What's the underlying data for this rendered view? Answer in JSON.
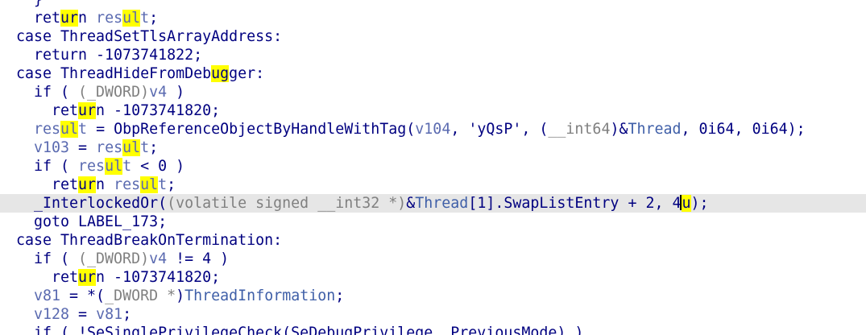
{
  "theme": {
    "background": "#ffffff",
    "current_line": "#e6e6e6",
    "highlight": "#ffff00",
    "colors": {
      "kw": "#000080",
      "var": "#5a6ab0",
      "gvar": "#3f5fa8",
      "cmt": "#808080",
      "str": "#008000",
      "num": "#000080",
      "plain": "#000080"
    }
  },
  "editor": {
    "current_line_index": 11,
    "lines": [
      {
        "indent": 2,
        "tokens": [
          [
            "kw",
            "}"
          ]
        ]
      },
      {
        "indent": 2,
        "tokens": [
          [
            "kw",
            "ret"
          ],
          [
            "kw",
            "ur",
            "hl"
          ],
          [
            "kw",
            "n "
          ],
          [
            "var",
            "res"
          ],
          [
            "var",
            "ul",
            "hl"
          ],
          [
            "var",
            "t"
          ],
          [
            "kw",
            ";"
          ]
        ]
      },
      {
        "indent": 1,
        "tokens": [
          [
            "kw",
            "case ThreadSetTlsArrayAddress:"
          ]
        ]
      },
      {
        "indent": 2,
        "tokens": [
          [
            "kw",
            "return -1073741822;"
          ]
        ]
      },
      {
        "indent": 1,
        "tokens": [
          [
            "kw",
            "case ThreadHideFromDeb"
          ],
          [
            "kw",
            "ug",
            "hl"
          ],
          [
            "kw",
            "ger:"
          ]
        ]
      },
      {
        "indent": 2,
        "tokens": [
          [
            "kw",
            "if ( "
          ],
          [
            "cmt",
            "(_DWORD)"
          ],
          [
            "var",
            "v4"
          ],
          [
            "kw",
            " )"
          ]
        ]
      },
      {
        "indent": 3,
        "tokens": [
          [
            "kw",
            "ret"
          ],
          [
            "kw",
            "ur",
            "hl"
          ],
          [
            "kw",
            "n -1073741820;"
          ]
        ]
      },
      {
        "indent": 2,
        "tokens": [
          [
            "var",
            "res"
          ],
          [
            "var",
            "ul",
            "hl"
          ],
          [
            "var",
            "t"
          ],
          [
            "kw",
            " = ObpReferenceObjectByHandleWithTag("
          ],
          [
            "var",
            "v104"
          ],
          [
            "kw",
            ", 'yQsP', ("
          ],
          [
            "cmt",
            "__int64"
          ],
          [
            "kw",
            ")&"
          ],
          [
            "gvar",
            "Thread"
          ],
          [
            "kw",
            ", 0i64, 0i64);"
          ]
        ]
      },
      {
        "indent": 2,
        "tokens": [
          [
            "var",
            "v103"
          ],
          [
            "kw",
            " = "
          ],
          [
            "var",
            "res"
          ],
          [
            "var",
            "ul",
            "hl"
          ],
          [
            "var",
            "t"
          ],
          [
            "kw",
            ";"
          ]
        ]
      },
      {
        "indent": 2,
        "tokens": [
          [
            "kw",
            "if ( "
          ],
          [
            "var",
            "res"
          ],
          [
            "var",
            "ul",
            "hl"
          ],
          [
            "var",
            "t"
          ],
          [
            "kw",
            " < 0 )"
          ]
        ]
      },
      {
        "indent": 3,
        "tokens": [
          [
            "kw",
            "ret"
          ],
          [
            "kw",
            "ur",
            "hl"
          ],
          [
            "kw",
            "n "
          ],
          [
            "var",
            "res"
          ],
          [
            "var",
            "ul",
            "hl"
          ],
          [
            "var",
            "t"
          ],
          [
            "kw",
            ";"
          ]
        ]
      },
      {
        "indent": 2,
        "tokens": [
          [
            "kw",
            "_InterlockedOr("
          ],
          [
            "cmt",
            "(volatile signed __int32 *)"
          ],
          [
            "kw",
            "&"
          ],
          [
            "gvar",
            "Thread"
          ],
          [
            "kw",
            "[1].SwapListEntry + 2, 4"
          ],
          [
            "kw",
            "|"
          ],
          [
            "kw",
            "u",
            "hl"
          ],
          [
            "kw",
            ");"
          ]
        ]
      },
      {
        "indent": 2,
        "tokens": [
          [
            "kw",
            "goto LABEL_173;"
          ]
        ]
      },
      {
        "indent": 1,
        "tokens": [
          [
            "kw",
            "case ThreadBreakOnTermination:"
          ]
        ]
      },
      {
        "indent": 2,
        "tokens": [
          [
            "kw",
            "if ( "
          ],
          [
            "cmt",
            "(_DWORD)"
          ],
          [
            "var",
            "v4"
          ],
          [
            "kw",
            " != 4 )"
          ]
        ]
      },
      {
        "indent": 3,
        "tokens": [
          [
            "kw",
            "ret"
          ],
          [
            "kw",
            "ur",
            "hl"
          ],
          [
            "kw",
            "n -1073741820;"
          ]
        ]
      },
      {
        "indent": 2,
        "tokens": [
          [
            "var",
            "v81"
          ],
          [
            "kw",
            " = *("
          ],
          [
            "cmt",
            "_DWORD *"
          ],
          [
            "kw",
            ")"
          ],
          [
            "gvar",
            "ThreadInformation"
          ],
          [
            "kw",
            ";"
          ]
        ]
      },
      {
        "indent": 2,
        "tokens": [
          [
            "var",
            "v128"
          ],
          [
            "kw",
            " = "
          ],
          [
            "var",
            "v81"
          ],
          [
            "kw",
            ";"
          ]
        ]
      },
      {
        "indent": 2,
        "tokens": [
          [
            "kw",
            "if ( !SeSinglePrivilegeCheck(SeDebugPrivilege, PreviousMode) )"
          ]
        ]
      }
    ]
  }
}
